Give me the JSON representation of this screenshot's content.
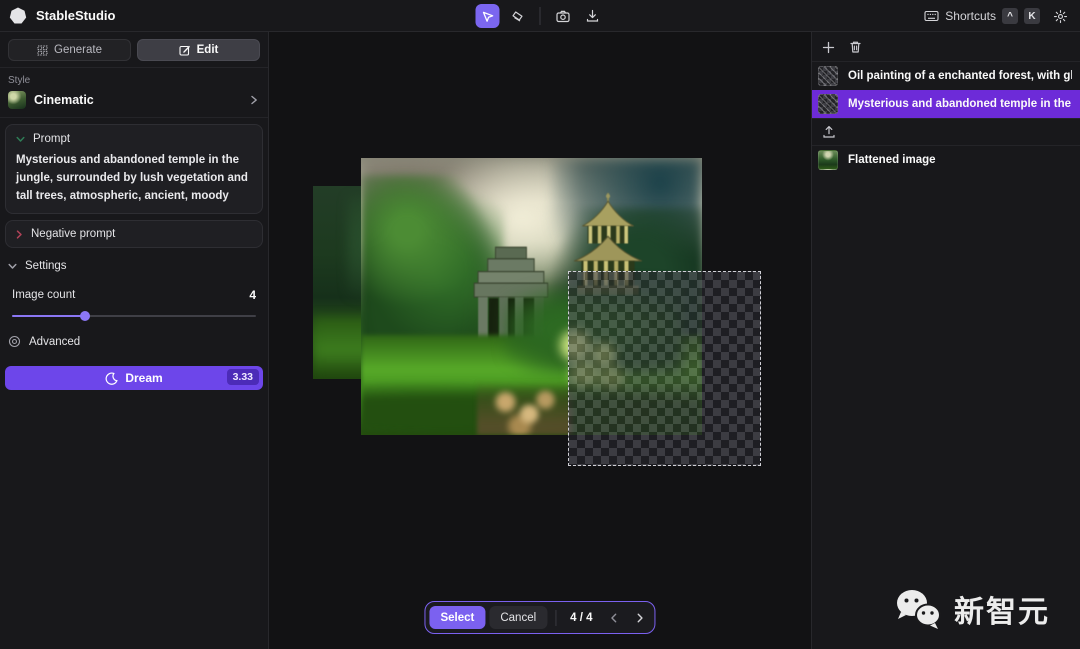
{
  "app": {
    "title": "StableStudio"
  },
  "topbar": {
    "shortcuts_label": "Shortcuts",
    "shortcut_keys": {
      "mod": "^",
      "key": "K"
    }
  },
  "left_panel": {
    "tabs": {
      "generate": "Generate",
      "edit": "Edit"
    },
    "style": {
      "label": "Style",
      "value": "Cinematic"
    },
    "prompt": {
      "header": "Prompt",
      "text": "Mysterious and abandoned temple in the jungle, surrounded by lush vegetation and tall trees, atmospheric, ancient, moody"
    },
    "negative_prompt": {
      "header": "Negative prompt"
    },
    "settings": {
      "header": "Settings",
      "image_count_label": "Image count",
      "image_count_value": "4",
      "advanced_label": "Advanced"
    },
    "dream_button": {
      "label": "Dream",
      "cost_badge": "3.33"
    }
  },
  "canvas": {
    "bottom_bar": {
      "select_label": "Select",
      "cancel_label": "Cancel",
      "page_indicator": "4 / 4"
    }
  },
  "right_panel": {
    "layers": [
      {
        "label": "Oil painting of a enchanted forest, with glowing ...",
        "selected": false
      },
      {
        "label": "Mysterious and abandoned temple in the jungle, ...",
        "selected": true
      }
    ],
    "flattened_layer": {
      "label": "Flattened image"
    }
  },
  "watermark": {
    "text": "新智元"
  },
  "colors": {
    "accent_purple": "#7b61f0",
    "selected_layer_purple": "#6d2bd8",
    "dream_button_purple": "#6d46ea",
    "dream_badge_purple": "#4c2bb8",
    "panel_bg": "#18181b",
    "canvas_bg": "#121214"
  }
}
